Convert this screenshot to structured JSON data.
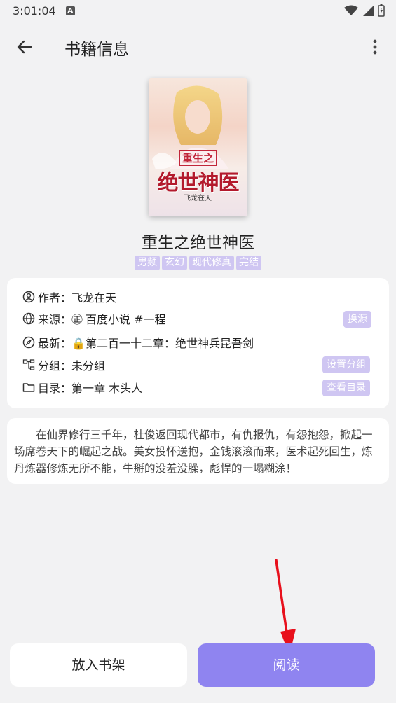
{
  "status_bar": {
    "time": "3:01:04",
    "notif_letter": "A"
  },
  "app_bar": {
    "title": "书籍信息"
  },
  "cover": {
    "title_small": "重生之",
    "title_big": "绝世神医",
    "author": "飞龙在天"
  },
  "book": {
    "title": "重生之绝世神医",
    "tags": [
      "男频",
      "玄幻",
      "现代修真",
      "完结"
    ]
  },
  "info": {
    "author_label": "作者：",
    "author": "飞龙在天",
    "source_label": "来源：",
    "source_badge": "㊣",
    "source": "百度小说 #一程",
    "latest_label": "最新：",
    "latest": "🔒第二百一十二章：绝世神兵昆吾剑",
    "group_label": "分组：",
    "group": "未分组",
    "toc_label": "目录：",
    "toc": "第一章 木头人",
    "change_source_btn": "换源",
    "set_group_btn": "设置分组",
    "view_toc_btn": "查看目录"
  },
  "description": "在仙界修行三千年，杜俊返回现代都市，有仇报仇，有怨抱怨，掀起一场席卷天下的崛起之战。美女投怀送抱，金钱滚滚而来，医术起死回生，炼丹炼器修炼无所不能，牛掰的没羞没臊，彪悍的一塌糊涂！",
  "actions": {
    "add_shelf": "放入书架",
    "read": "阅读"
  },
  "colors": {
    "accent": "#8f84f0",
    "tag_bg": "#cfc6f2",
    "annotation": "#e8101c"
  }
}
